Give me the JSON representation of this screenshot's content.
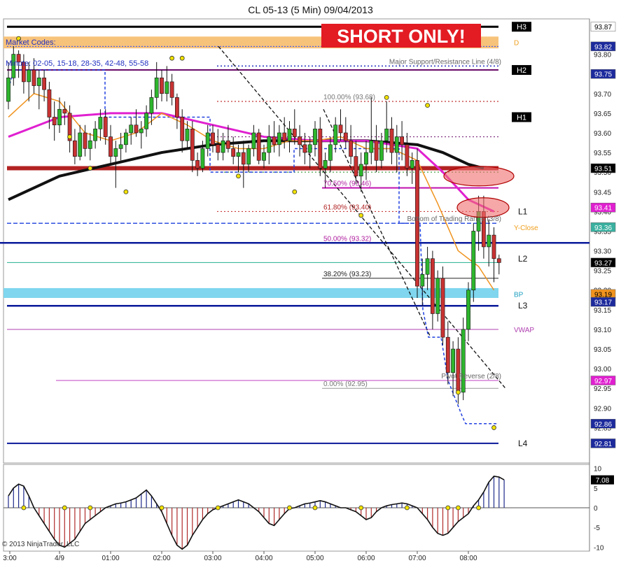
{
  "window": {
    "title": "CL 05-13 (5 Min)  09/04/2013"
  },
  "banner": {
    "text": "SHORT ONLY!"
  },
  "notes": {
    "market_codes": "Market Codes:",
    "minute": "Minute: 02-05,  15-18, 28-35,  42-48,  55-58",
    "copyright": "© 2013 NinjaTrader, LLC"
  },
  "colors": {
    "candle_up": "#2db52d",
    "candle_down": "#c83232",
    "ema_fast": "#f0931e",
    "ema_mid": "#e020d0",
    "ema_slow": "#111111",
    "resistance": "#b22222",
    "blue_line": "#0a1a9a",
    "banner_bg": "#e31b23",
    "zone_orange": "#f7c27a",
    "zone_cyan": "#7fd6ee"
  },
  "chart_data": {
    "type": "candlestick",
    "title": "CL 05-13 (5 Min)  09/04/2013",
    "ylim": [
      92.76,
      93.89
    ],
    "y_ticks": [
      "93.80",
      "93.70",
      "93.65",
      "93.60",
      "93.55",
      "93.50",
      "93.45",
      "93.40",
      "93.35",
      "93.30",
      "93.25",
      "93.20",
      "93.15",
      "93.10",
      "93.05",
      "93.00",
      "92.95",
      "92.90",
      "92.85"
    ],
    "x_ticks": [
      {
        "label": "3:00",
        "bar": 0
      },
      {
        "label": "4/9",
        "bar": 10
      },
      {
        "label": "01:00",
        "bar": 20
      },
      {
        "label": "02:00",
        "bar": 30
      },
      {
        "label": "03:00",
        "bar": 40
      },
      {
        "label": "04:00",
        "bar": 50
      },
      {
        "label": "05:00",
        "bar": 60
      },
      {
        "label": "06:00",
        "bar": 70
      },
      {
        "label": "07:00",
        "bar": 80
      },
      {
        "label": "08:00",
        "bar": 90
      }
    ],
    "price_labels": [
      {
        "value": 93.87,
        "text": "93.87",
        "bg": "#ffffff",
        "fg": "#000000"
      },
      {
        "value": 93.82,
        "text": "93.82",
        "bg": "#1c2a9c",
        "fg": "#ffffff"
      },
      {
        "value": 93.75,
        "text": "93.75",
        "bg": "#1c2a9c",
        "fg": "#ffffff"
      },
      {
        "value": 93.51,
        "text": "93.51",
        "bg": "#000000",
        "fg": "#ffffff"
      },
      {
        "value": 93.41,
        "text": "93.41",
        "bg": "#e020d0",
        "fg": "#ffffff"
      },
      {
        "value": 93.36,
        "text": "93.36",
        "bg": "#3ab0a0",
        "fg": "#ffffff"
      },
      {
        "value": 93.27,
        "text": "93.27",
        "bg": "#000000",
        "fg": "#ffffff"
      },
      {
        "value": 93.19,
        "text": "93.19",
        "bg": "#f0931e",
        "fg": "#000000"
      },
      {
        "value": 93.17,
        "text": "93.17",
        "bg": "#1c2a9c",
        "fg": "#ffffff"
      },
      {
        "value": 92.97,
        "text": "92.97",
        "bg": "#e020d0",
        "fg": "#ffffff"
      },
      {
        "value": 92.86,
        "text": "92.86",
        "bg": "#1c2a9c",
        "fg": "#ffffff"
      },
      {
        "value": 92.81,
        "text": "92.81",
        "bg": "#1c2a9c",
        "fg": "#ffffff"
      }
    ],
    "level_tags": [
      {
        "text": "H3",
        "value": 93.87,
        "style": "box"
      },
      {
        "text": "H2",
        "value": 93.76,
        "style": "box"
      },
      {
        "text": "H1",
        "value": 93.64,
        "style": "box"
      },
      {
        "text": "L1",
        "value": 93.4,
        "style": "plain"
      },
      {
        "text": "L2",
        "value": 93.28,
        "style": "plain"
      },
      {
        "text": "L3",
        "value": 93.16,
        "style": "plain"
      },
      {
        "text": "L4",
        "value": 92.81,
        "style": "plain"
      },
      {
        "text": "D",
        "value": 93.83,
        "style": "orange"
      },
      {
        "text": "Y-Close",
        "value": 93.36,
        "style": "orange"
      },
      {
        "text": "BP",
        "value": 93.19,
        "style": "cyan"
      },
      {
        "text": "VWAP",
        "value": 93.1,
        "style": "violet"
      }
    ],
    "fib_levels": [
      {
        "label": "100.00% (93.68)",
        "value": 93.68
      },
      {
        "label": "70.50% (93.46)",
        "value": 93.46
      },
      {
        "label": "61.80% (93.40)",
        "value": 93.4
      },
      {
        "label": "50.00% (93.32)",
        "value": 93.32
      },
      {
        "label": "38.20% (93.23)",
        "value": 93.23
      },
      {
        "label": "0.00% (92.95)",
        "value": 92.95
      }
    ],
    "annotations": [
      {
        "text": "Major Support/Resistance Line (4/8)",
        "value": 93.77
      },
      {
        "text": "Bottom of Trading Range (3/8)",
        "value": 93.37
      },
      {
        "text": "Pivot Reverse (2/8)",
        "value": 92.97
      }
    ],
    "candles": [
      [
        93.68,
        93.78,
        93.66,
        93.74
      ],
      [
        93.74,
        93.82,
        93.72,
        93.8
      ],
      [
        93.8,
        93.81,
        93.74,
        93.78
      ],
      [
        93.78,
        93.8,
        93.7,
        93.73
      ],
      [
        93.73,
        93.78,
        93.68,
        93.76
      ],
      [
        93.76,
        93.79,
        93.7,
        93.72
      ],
      [
        93.72,
        93.76,
        93.66,
        93.74
      ],
      [
        93.74,
        93.76,
        93.68,
        93.71
      ],
      [
        93.71,
        93.73,
        93.61,
        93.64
      ],
      [
        93.64,
        93.68,
        93.58,
        93.62
      ],
      [
        93.62,
        93.69,
        93.6,
        93.66
      ],
      [
        93.66,
        93.68,
        93.62,
        93.65
      ],
      [
        93.65,
        93.67,
        93.55,
        93.58
      ],
      [
        93.58,
        93.61,
        93.52,
        93.54
      ],
      [
        93.54,
        93.62,
        93.53,
        93.6
      ],
      [
        93.6,
        93.62,
        93.54,
        93.56
      ],
      [
        93.56,
        93.6,
        93.53,
        93.58
      ],
      [
        93.58,
        93.63,
        93.56,
        93.61
      ],
      [
        93.61,
        93.66,
        93.58,
        93.64
      ],
      [
        93.64,
        93.66,
        93.57,
        93.59
      ],
      [
        93.59,
        93.62,
        93.52,
        93.54
      ],
      [
        93.54,
        93.58,
        93.46,
        93.56
      ],
      [
        93.56,
        93.6,
        93.53,
        93.57
      ],
      [
        93.57,
        93.61,
        93.55,
        93.6
      ],
      [
        93.6,
        93.64,
        93.57,
        93.62
      ],
      [
        93.62,
        93.66,
        93.59,
        93.6
      ],
      [
        93.6,
        93.63,
        93.56,
        93.61
      ],
      [
        93.61,
        93.67,
        93.59,
        93.65
      ],
      [
        93.65,
        93.71,
        93.62,
        93.69
      ],
      [
        93.69,
        93.78,
        93.66,
        93.74
      ],
      [
        93.74,
        93.76,
        93.68,
        93.7
      ],
      [
        93.7,
        93.77,
        93.68,
        93.73
      ],
      [
        93.73,
        93.75,
        93.67,
        93.69
      ],
      [
        93.69,
        93.7,
        93.61,
        93.64
      ],
      [
        93.64,
        93.66,
        93.55,
        93.58
      ],
      [
        93.58,
        93.63,
        93.56,
        93.61
      ],
      [
        93.61,
        93.63,
        93.5,
        93.53
      ],
      [
        93.53,
        93.55,
        93.49,
        93.51
      ],
      [
        93.51,
        93.58,
        93.5,
        93.56
      ],
      [
        93.56,
        93.62,
        93.54,
        93.6
      ],
      [
        93.6,
        93.62,
        93.55,
        93.57
      ],
      [
        93.57,
        93.61,
        93.53,
        93.55
      ],
      [
        93.55,
        93.6,
        93.53,
        93.58
      ],
      [
        93.58,
        93.62,
        93.55,
        93.56
      ],
      [
        93.56,
        93.59,
        93.52,
        93.54
      ],
      [
        93.54,
        93.57,
        93.5,
        93.55
      ],
      [
        93.55,
        93.58,
        93.46,
        93.52
      ],
      [
        93.52,
        93.57,
        93.5,
        93.56
      ],
      [
        93.56,
        93.62,
        93.54,
        93.6
      ],
      [
        93.6,
        93.61,
        93.52,
        93.53
      ],
      [
        93.53,
        93.57,
        93.51,
        93.55
      ],
      [
        93.55,
        93.62,
        93.52,
        93.59
      ],
      [
        93.59,
        93.63,
        93.55,
        93.57
      ],
      [
        93.57,
        93.62,
        93.54,
        93.6
      ],
      [
        93.6,
        93.64,
        93.56,
        93.58
      ],
      [
        93.58,
        93.63,
        93.55,
        93.61
      ],
      [
        93.61,
        93.66,
        93.57,
        93.59
      ],
      [
        93.59,
        93.62,
        93.54,
        93.57
      ],
      [
        93.57,
        93.6,
        93.52,
        93.55
      ],
      [
        93.55,
        93.59,
        93.51,
        93.57
      ],
      [
        93.57,
        93.63,
        93.54,
        93.61
      ],
      [
        93.61,
        93.64,
        93.49,
        93.51
      ],
      [
        93.51,
        93.55,
        93.46,
        93.53
      ],
      [
        93.53,
        93.59,
        93.5,
        93.57
      ],
      [
        93.57,
        93.64,
        93.55,
        93.62
      ],
      [
        93.62,
        93.66,
        93.58,
        93.6
      ],
      [
        93.6,
        93.64,
        93.56,
        93.58
      ],
      [
        93.58,
        93.62,
        93.52,
        93.54
      ],
      [
        93.54,
        93.58,
        93.47,
        93.49
      ],
      [
        93.49,
        93.55,
        93.45,
        93.52
      ],
      [
        93.52,
        93.58,
        93.48,
        93.55
      ],
      [
        93.55,
        93.69,
        93.52,
        93.58
      ],
      [
        93.58,
        93.62,
        93.5,
        93.53
      ],
      [
        93.53,
        93.6,
        93.51,
        93.58
      ],
      [
        93.58,
        93.68,
        93.55,
        93.61
      ],
      [
        93.61,
        93.64,
        93.52,
        93.55
      ],
      [
        93.55,
        93.62,
        93.5,
        93.59
      ],
      [
        93.59,
        93.63,
        93.53,
        93.57
      ],
      [
        93.57,
        93.6,
        93.49,
        93.51
      ],
      [
        93.51,
        93.55,
        93.47,
        93.53
      ],
      [
        93.53,
        93.56,
        93.18,
        93.21
      ],
      [
        93.21,
        93.28,
        93.16,
        93.24
      ],
      [
        93.24,
        93.31,
        93.2,
        93.28
      ],
      [
        93.28,
        93.3,
        93.1,
        93.14
      ],
      [
        93.14,
        93.25,
        93.12,
        93.23
      ],
      [
        93.23,
        93.26,
        93.06,
        93.08
      ],
      [
        93.08,
        93.12,
        92.96,
        92.99
      ],
      [
        92.99,
        93.07,
        92.93,
        93.05
      ],
      [
        93.05,
        93.08,
        92.91,
        92.94
      ],
      [
        92.94,
        93.13,
        92.92,
        93.1
      ],
      [
        93.1,
        93.22,
        93.07,
        93.2
      ],
      [
        93.2,
        93.37,
        93.17,
        93.35
      ],
      [
        93.35,
        93.44,
        93.3,
        93.4
      ],
      [
        93.4,
        93.44,
        93.28,
        93.31
      ],
      [
        93.31,
        93.38,
        93.26,
        93.34
      ],
      [
        93.34,
        93.36,
        93.22,
        93.28
      ],
      [
        93.28,
        93.29,
        93.24,
        93.27
      ]
    ],
    "ema_fast": [
      [
        0,
        93.64
      ],
      [
        5,
        93.7
      ],
      [
        10,
        93.68
      ],
      [
        15,
        93.6
      ],
      [
        20,
        93.58
      ],
      [
        25,
        93.6
      ],
      [
        30,
        93.65
      ],
      [
        35,
        93.62
      ],
      [
        40,
        93.58
      ],
      [
        45,
        93.56
      ],
      [
        50,
        93.56
      ],
      [
        55,
        93.58
      ],
      [
        60,
        93.58
      ],
      [
        65,
        93.59
      ],
      [
        70,
        93.56
      ],
      [
        75,
        93.56
      ],
      [
        80,
        93.53
      ],
      [
        84,
        93.42
      ],
      [
        88,
        93.3
      ],
      [
        92,
        93.26
      ],
      [
        95,
        93.2
      ]
    ],
    "ema_mid": [
      [
        0,
        93.59
      ],
      [
        10,
        93.64
      ],
      [
        20,
        93.65
      ],
      [
        30,
        93.65
      ],
      [
        40,
        93.62
      ],
      [
        50,
        93.59
      ],
      [
        60,
        93.58
      ],
      [
        70,
        93.58
      ],
      [
        80,
        93.56
      ],
      [
        85,
        93.5
      ],
      [
        90,
        93.43
      ],
      [
        95,
        93.4
      ]
    ],
    "ema_slow": [
      [
        0,
        93.43
      ],
      [
        10,
        93.49
      ],
      [
        20,
        93.52
      ],
      [
        30,
        93.55
      ],
      [
        40,
        93.57
      ],
      [
        50,
        93.58
      ],
      [
        60,
        93.58
      ],
      [
        70,
        93.58
      ],
      [
        80,
        93.57
      ],
      [
        85,
        93.55
      ],
      [
        90,
        93.52
      ],
      [
        93,
        93.51
      ]
    ],
    "oscillator": {
      "ylim": [
        -11,
        11
      ],
      "ticks": [
        10,
        5,
        0,
        -5,
        -10
      ],
      "last_value": "7.08",
      "values": [
        3,
        5,
        6,
        5.5,
        3,
        0,
        -2,
        -4,
        -6,
        -8,
        -9.5,
        -10,
        -9,
        -8,
        -6,
        -4,
        -3,
        -2,
        -1,
        0,
        0.5,
        1,
        1.2,
        1.5,
        2,
        2.5,
        3.5,
        4.5,
        3,
        1,
        -1,
        -4,
        -7,
        -9.5,
        -10.5,
        -9.5,
        -7,
        -5,
        -3,
        -1.5,
        -0.5,
        0,
        0.5,
        1,
        1.5,
        2,
        1.5,
        1,
        0,
        -1,
        -2.5,
        -4,
        -4.5,
        -3,
        -1.5,
        -0.2,
        0,
        0.5,
        1,
        1.2,
        1.5,
        1.8,
        1.5,
        1,
        0.5,
        0,
        0,
        -0.5,
        -1,
        -2,
        -3,
        -2.5,
        -1,
        0,
        0.5,
        0.8,
        1,
        1.2,
        1,
        0.5,
        0,
        -1.5,
        -3,
        -5,
        -6.5,
        -7,
        -6.5,
        -5,
        -3.5,
        -2.5,
        -1.5,
        0.5,
        2,
        4,
        6.5,
        8,
        7.8,
        7.08
      ]
    }
  }
}
